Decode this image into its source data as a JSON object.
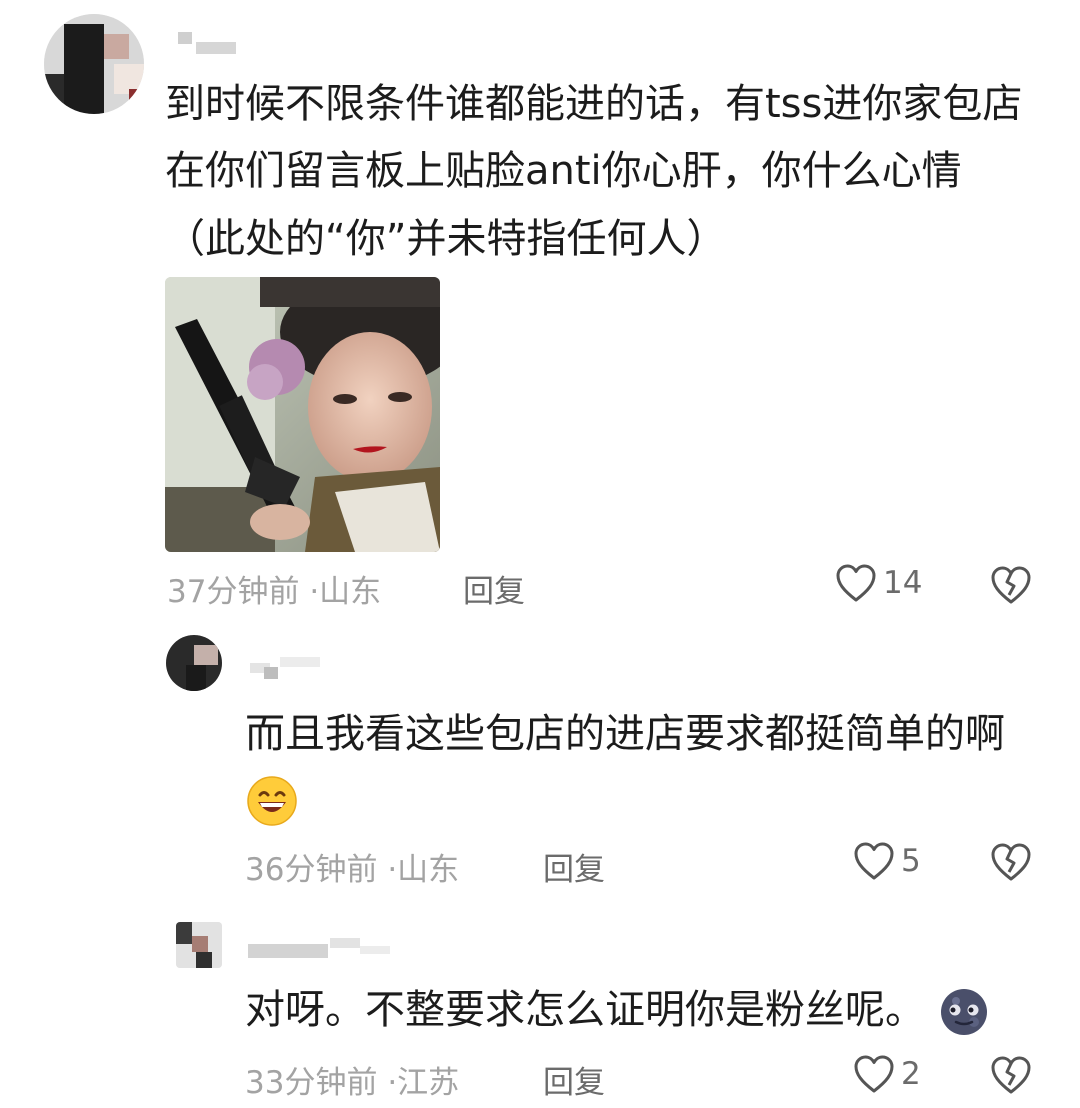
{
  "comments": [
    {
      "lines": [
        "到时候不限条件谁都能进的话，有tss进你家包店",
        "在你们留言板上贴脸anti你心肝，你什么心情",
        "（此处的“你”并未特指任何人）"
      ],
      "time": "37分钟前",
      "location": "山东",
      "reply_label": "回复",
      "like_count": "14",
      "media_image": "drama-still-woman-holding-gun"
    },
    {
      "lines": [
        "而且我看这些包店的进店要求都挺简单的啊"
      ],
      "emoji": "grinning-sweat-emoji",
      "time": "36分钟前",
      "location": "山东",
      "reply_label": "回复",
      "like_count": "5"
    },
    {
      "lines": [
        "对呀。不整要求怎么证明你是粉丝呢。"
      ],
      "emoji": "new-moon-face-emoji",
      "time": "33分钟前",
      "location": "江苏",
      "reply_label": "回复",
      "like_count": "2"
    }
  ],
  "meta_separator": "·",
  "icons": {
    "like": "heart-outline-icon",
    "dislike": "broken-heart-icon"
  },
  "colors": {
    "text": "#1c1c1c",
    "meta": "#a3a3a3",
    "action": "#6b6b6b"
  }
}
